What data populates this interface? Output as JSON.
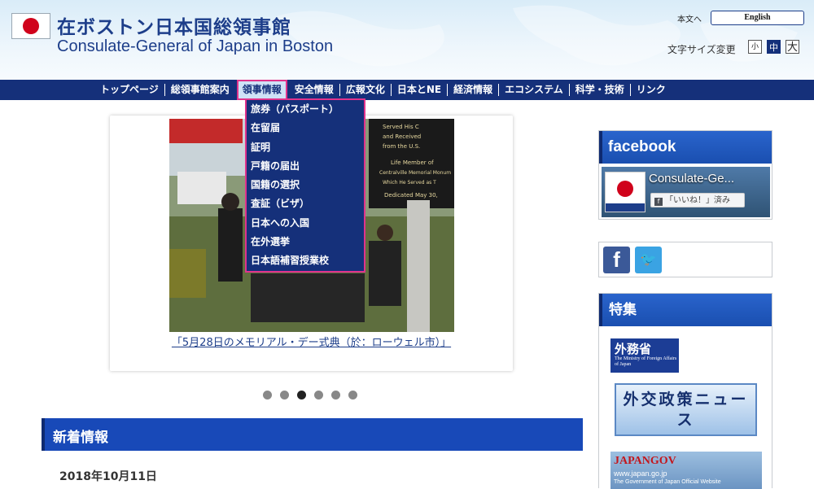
{
  "header": {
    "title_jp": "在ボストン日本国総領事館",
    "title_en": "Consulate-General of Japan in Boston",
    "skip_link": "本文へ",
    "language_button": "English",
    "font_size_label": "文字サイズ変更",
    "font_sizes": [
      "小",
      "中",
      "大"
    ]
  },
  "nav": {
    "items": [
      "トップページ",
      "総領事館案内",
      "領事情報",
      "安全情報",
      "広報文化",
      "日本とNE",
      "経済情報",
      "エコシステム",
      "科学・技術",
      "リンク"
    ],
    "active": "領事情報"
  },
  "dropdown": {
    "items": [
      "旅券（パスポート）",
      "在留届",
      "証明",
      "戸籍の届出",
      "国籍の選択",
      "査証（ビザ）",
      "日本への入国",
      "在外選挙",
      "日本語補習授業校"
    ]
  },
  "slider": {
    "caption": "「5月28日のメモリアル・デー式典（於：ローウェル市）」",
    "plaque_lines": [
      "Served His C",
      "and Received",
      "from the U.S.",
      "Life Member of",
      "Centralville Memorial Monum",
      "Which He Served as T",
      "Dedicated May 30,"
    ],
    "dot_count": 6,
    "active_dot": 2
  },
  "news": {
    "title": "新着情報",
    "date": "2018年10月11日"
  },
  "sidebar": {
    "facebook_title": "facebook",
    "facebook_page_name": "Consulate-Ge...",
    "facebook_like": "「いいね！」済み",
    "feature_title": "特集",
    "mofa_banner_big": "外務省",
    "mofa_banner_small": "The Ministry of Foreign Affairs of Japan",
    "diplomacy_news": "外交政策ニュース",
    "japangov_title": "JAPANGOV",
    "japangov_url": "www.japan.go.jp",
    "japangov_sub": "The Government of Japan Official Website"
  },
  "colors": {
    "nav_bg": "#15307a",
    "highlight": "#e0338c",
    "header_blue": "#1d3e8a",
    "section_blue": "#1849b8"
  }
}
